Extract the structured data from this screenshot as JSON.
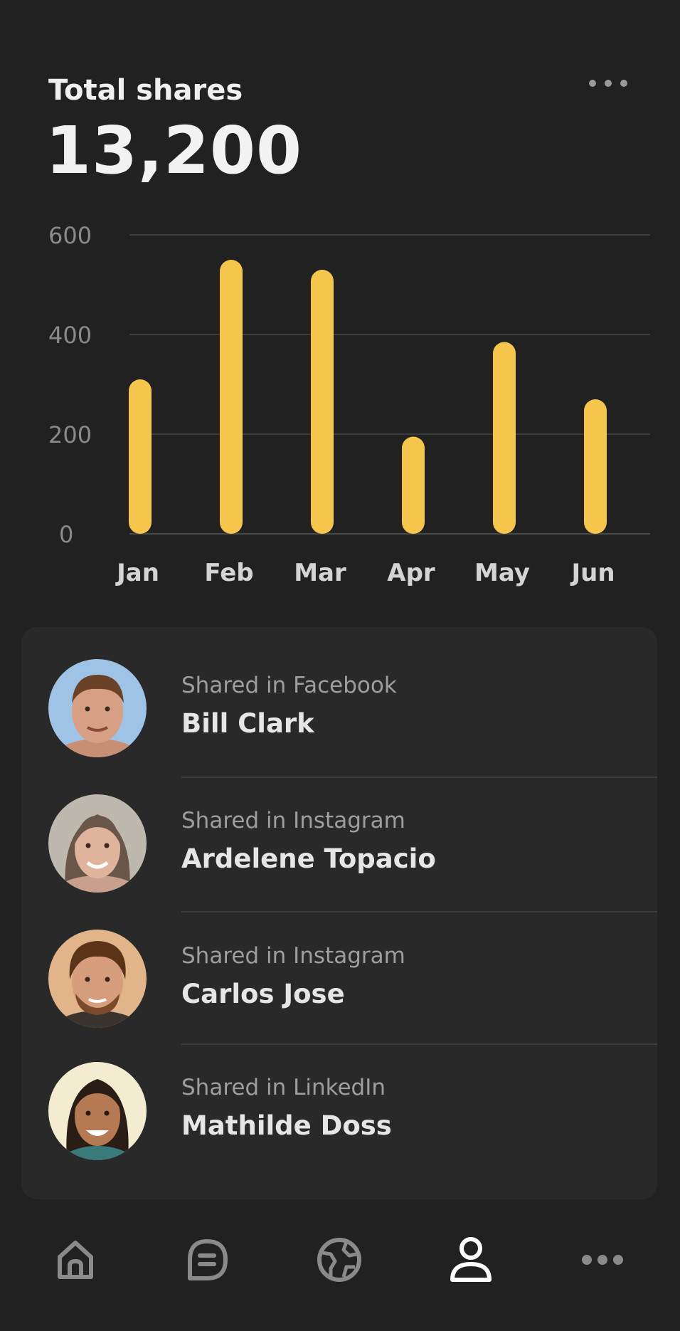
{
  "header": {
    "title": "Total shares",
    "total": "13,200"
  },
  "chart_data": {
    "type": "bar",
    "categories": [
      "Jan",
      "Feb",
      "Mar",
      "Apr",
      "May",
      "Jun"
    ],
    "values": [
      310,
      550,
      530,
      195,
      385,
      270
    ],
    "yticks": [
      "0",
      "200",
      "400",
      "600"
    ],
    "ylim": [
      0,
      600
    ],
    "grid": true,
    "bar_color": "#F5C64B"
  },
  "shares": [
    {
      "network": "Shared in Facebook",
      "name": "Bill Clark"
    },
    {
      "network": "Shared in Instagram",
      "name": "Ardelene Topacio"
    },
    {
      "network": "Shared in Instagram",
      "name": "Carlos Jose"
    },
    {
      "network": "Shared in LinkedIn",
      "name": "Mathilde Doss"
    }
  ],
  "nav": [
    "home-icon",
    "chat-icon",
    "globe-icon",
    "profile-icon",
    "more-icon"
  ],
  "colors": {
    "background": "#212121",
    "card": "#292929",
    "accent": "#F5C64B",
    "active_icon": "#ffffff",
    "inactive_icon": "#8a8a8a"
  }
}
